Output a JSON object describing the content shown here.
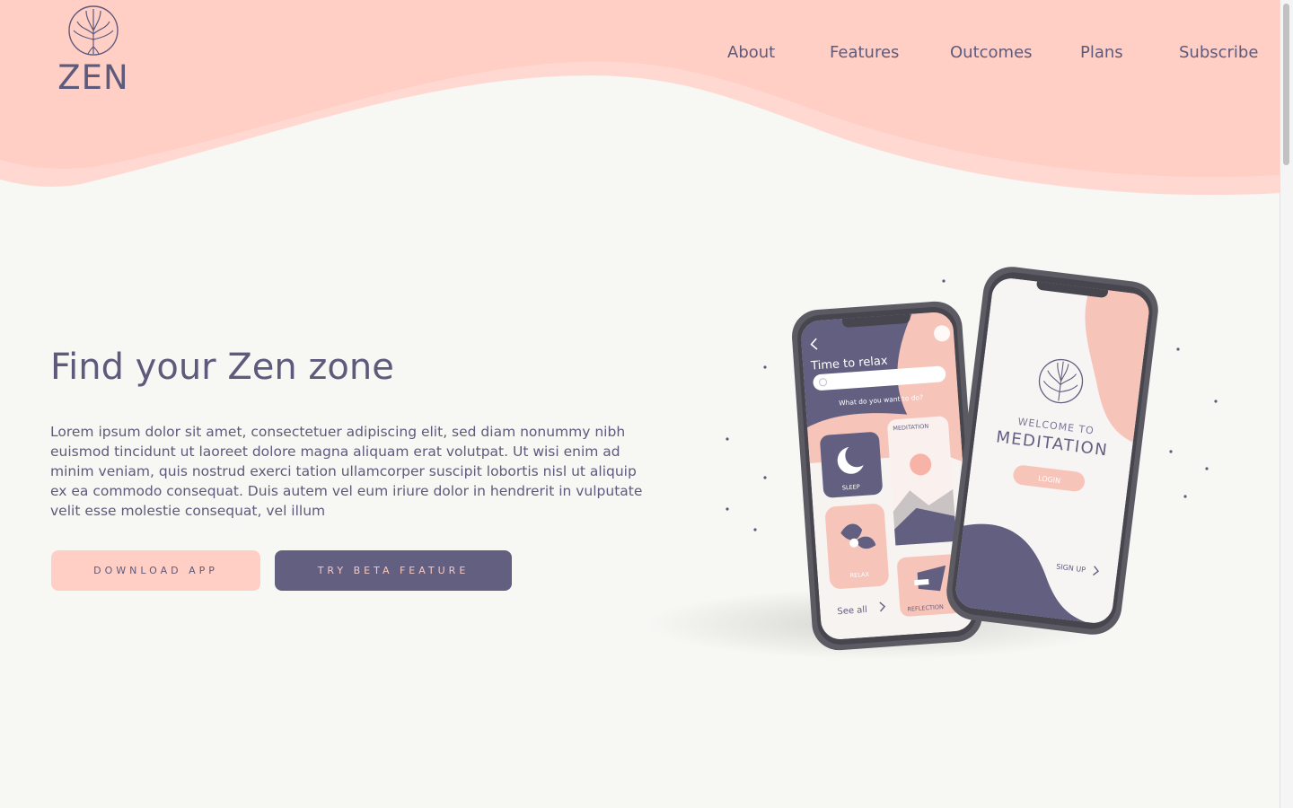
{
  "brand": {
    "name": "ZEN",
    "logo_icon": "tree-icon"
  },
  "nav": {
    "items": [
      {
        "label": "About"
      },
      {
        "label": "Features"
      },
      {
        "label": "Outcomes"
      },
      {
        "label": "Plans"
      },
      {
        "label": "Subscribe"
      }
    ]
  },
  "hero": {
    "title": "Find your Zen zone",
    "body": "Lorem ipsum dolor sit amet, consectetuer adipiscing elit, sed diam nonummy nibh euismod tincidunt ut laoreet dolore magna aliquam erat volutpat. Ut wisi enim ad minim veniam, quis nostrud exerci tation ullamcorper suscipit lobortis nisl ut aliquip ex ea commodo consequat. Duis autem vel eum iriure dolor in hendrerit in vulputate velit esse molestie consequat, vel illum",
    "download_label": "DOWNLOAD APP",
    "beta_label": "TRY BETA FEATURE"
  },
  "phone_left": {
    "title": "Time to relax",
    "prompt": "What do you want to do?",
    "card_sleep": "SLEEP",
    "card_meditation": "MEDITATION",
    "card_relax": "RELAX",
    "card_reflection": "REFLECTION",
    "see_all": "See all"
  },
  "phone_right": {
    "welcome": "WELCOME TO",
    "meditation": "MEDITATION",
    "login": "LOGIN",
    "signup": "SIGN UP"
  },
  "colors": {
    "peach": "#ffcfc5",
    "indigo": "#635f80",
    "text": "#5e5a7c",
    "background": "#f7f7f4"
  }
}
